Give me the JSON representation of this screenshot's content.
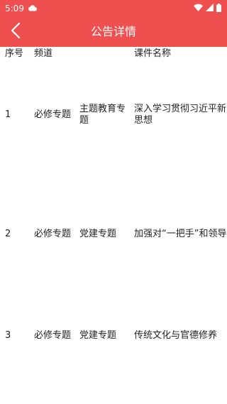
{
  "status_bar": {
    "time": "5:09"
  },
  "header": {
    "title": "公告详情"
  },
  "table": {
    "headers": {
      "no": "序号",
      "channel": "频道",
      "course": "课件名称"
    },
    "rows": [
      {
        "no": "1",
        "channel": "必修专题",
        "subject": "主题教育专题",
        "course_lines": [
          "深入学习贯彻习近平新",
          "思想"
        ]
      },
      {
        "no": "2",
        "channel": "必修专题",
        "subject": "党建专题",
        "course_lines": [
          "加强对“一把手”和领导"
        ]
      },
      {
        "no": "3",
        "channel": "必修专题",
        "subject": "党建专题",
        "course_lines": [
          "传统文化与官德修养"
        ]
      }
    ]
  },
  "colors": {
    "accent": "#ef4f4f"
  }
}
